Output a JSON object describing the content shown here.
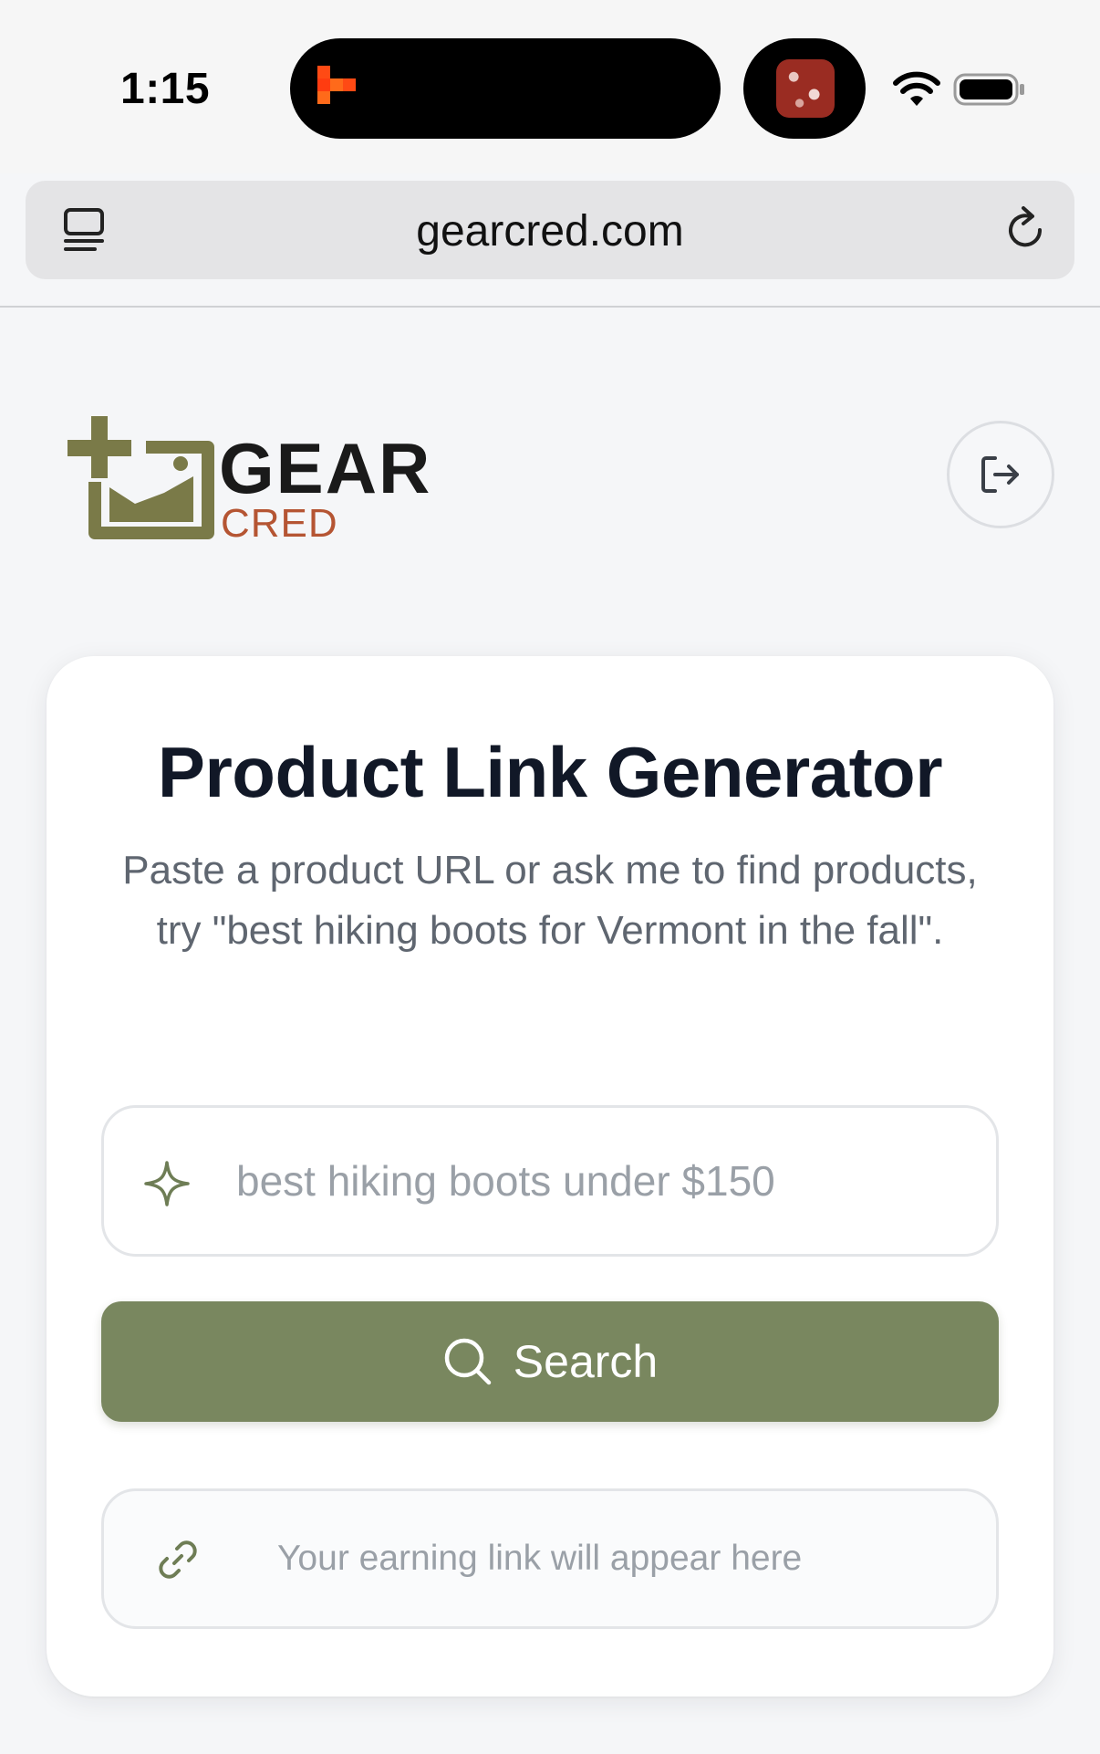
{
  "status_bar": {
    "time": "1:15"
  },
  "browser": {
    "url": "gearcred.com"
  },
  "logo": {
    "word_top": "GEAR",
    "word_bottom": "CRED",
    "colors": {
      "olive": "#7a7a48",
      "dark": "#1a1a1a",
      "rust": "#b55533"
    }
  },
  "card": {
    "title": "Product Link Generator",
    "subtitle": "Paste a product URL or ask me to find products, try \"best hiking boots for Vermont in the fall\".",
    "search_placeholder": "best hiking boots under $150",
    "search_button_label": "Search",
    "link_placeholder": "Your earning link will appear here"
  },
  "colors": {
    "accent": "#79875f",
    "background": "#f5f6f8",
    "card": "#ffffff"
  },
  "icons": {
    "tabs": "tabs-icon",
    "reload": "reload-icon",
    "logout": "logout-icon",
    "sparkle": "sparkle-icon",
    "search": "search-icon",
    "link": "link-icon"
  }
}
